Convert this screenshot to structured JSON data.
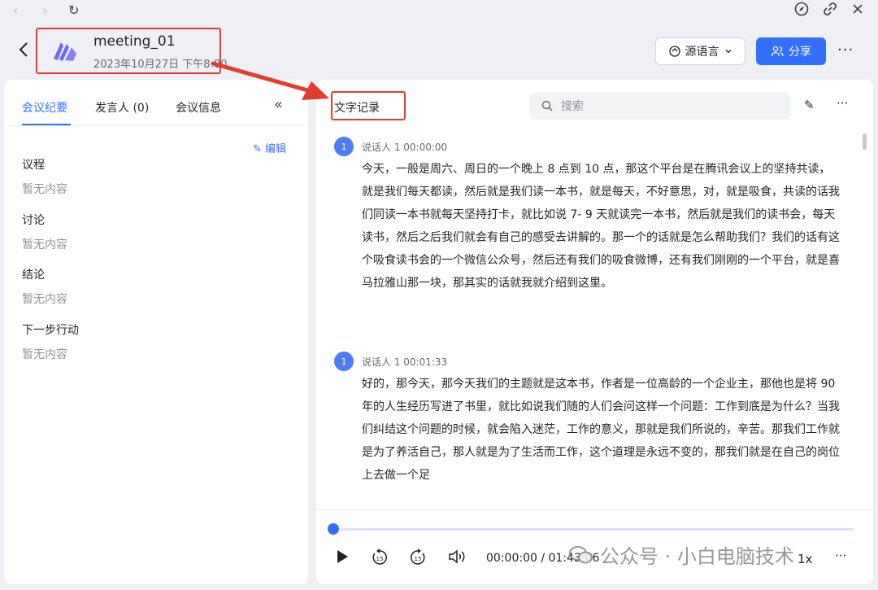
{
  "browser": {
    "back_glyph": "‹",
    "forward_glyph": "›",
    "reload_glyph": "↻",
    "icons": [
      "compass-icon",
      "link-icon",
      "close-icon"
    ]
  },
  "header": {
    "title": "meeting_01",
    "subtitle": "2023年10月27日 下午8:00",
    "lang_label": "源语言",
    "share_label": "分享"
  },
  "left": {
    "tabs": [
      {
        "label": "会议纪要",
        "active": true
      },
      {
        "label": "发言人 (0)",
        "active": false
      },
      {
        "label": "会议信息",
        "active": false
      }
    ],
    "edit_label": "编辑",
    "sections": [
      {
        "title": "议程",
        "empty": "暂无内容"
      },
      {
        "title": "讨论",
        "empty": "暂无内容"
      },
      {
        "title": "结论",
        "empty": "暂无内容"
      },
      {
        "title": "下一步行动",
        "empty": "暂无内容"
      }
    ]
  },
  "right": {
    "title": "文字记录",
    "search_placeholder": "搜索",
    "segments": [
      {
        "avatar": "1",
        "speaker": "说话人 1 00:00:00",
        "text": "今天，一般是周六、周日的一个晚上 8 点到 10 点，那这个平台是在腾讯会议上的坚持共读，就是我们每天都读，然后就是我们读一本书，就是每天，不好意思，对，就是吸食，共读的话我们同读一本书就每天坚持打卡，就比如说 7- 9 天就读完一本书，然后就是我们的读书会，每天读书，然后之后我们就会有自己的感受去讲解的。那一个的话就是怎么帮助我们？我们的话有这个吸食读书会的一个微信公众号，然后还有我们的吸食微博，还有我们刚刚的一个平台，就是喜马拉雅山那一块，那其实的话就我就介绍到这里。"
      },
      {
        "avatar": "1",
        "speaker": "说话人 1 00:01:33",
        "text": "好的，那今天，那今天我们的主题就是这本书，作者是一位高龄的一个企业主，那他也是将 90 年的人生经历写进了书里，就比如说我们随的人们会问这样一个问题：工作到底是为什么？当我们纠结这个问题的时候，就会陷入迷茫，工作的意义，那就是我们所说的，辛苦。那我们工作就是为了养活自己，那人就是为了生活而工作，这个道理是永远不变的，那我们就是在自己的岗位上去做一个足"
      }
    ]
  },
  "player": {
    "progress": 0.0,
    "time": "00:00:00 / 01:43:06",
    "skip_back": "15",
    "skip_fwd": "15",
    "speed": "1x"
  },
  "watermark": "公众号 · 小白电脑技术",
  "colors": {
    "accent": "#3370ff",
    "annotation": "#e23c2f"
  }
}
